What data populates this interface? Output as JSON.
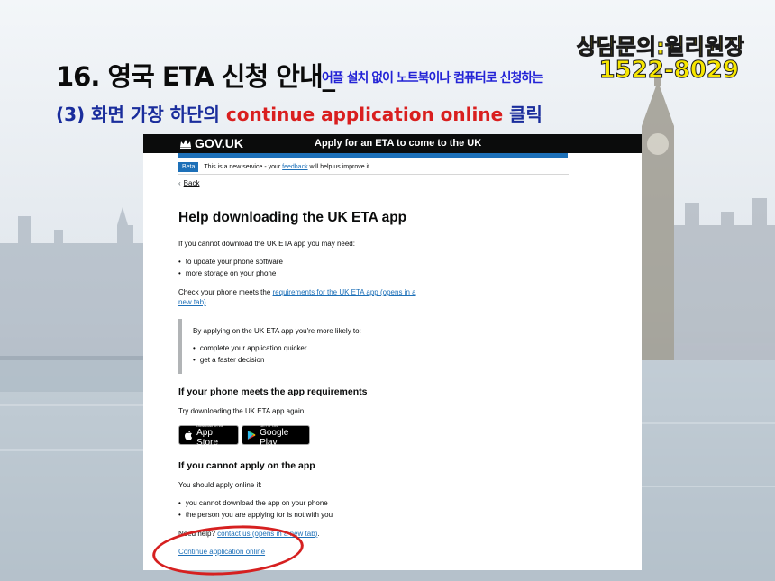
{
  "slide": {
    "title_main": "16. 영국 ETA 신청 안내_",
    "title_sub": "어플 설치 없이 노트북이나 컴퓨터로 신청하는",
    "contact_label": "상담문의:윌리원장",
    "contact_phone": "1522-8029",
    "subtitle_prefix": "(3) 화면 가장 하단의 ",
    "subtitle_highlight": "continue application online",
    "subtitle_suffix": " 클릭"
  },
  "header": {
    "logo": "GOV.UK",
    "service_name": "Apply for an ETA to come to the UK"
  },
  "phase_banner": {
    "tag": "Beta",
    "text_before": "This is a new service - your ",
    "link": "feedback",
    "text_after": " will help us improve it."
  },
  "back_link": "Back",
  "content": {
    "heading": "Help downloading the UK ETA app",
    "intro": "If you cannot download the UK ETA app you may need:",
    "needs": [
      "to update your phone software",
      "more storage on your phone"
    ],
    "check_before": "Check your phone meets the ",
    "check_link_line1": "requirements for the UK ETA app (opens in a",
    "check_link_line2": "new tab)",
    "check_after": ".",
    "inset_intro": "By applying on the UK ETA app you're more likely to:",
    "inset_items": [
      "complete your application quicker",
      "get a faster decision"
    ],
    "section1_heading": "If your phone meets the app requirements",
    "section1_text": "Try downloading the UK ETA app again.",
    "app_store_small": "Download on the",
    "app_store_big": "App Store",
    "google_play_small": "GET IT ON",
    "google_play_big": "Google Play",
    "section2_heading": "If you cannot apply on the app",
    "section2_intro": "You should apply online if:",
    "section2_items": [
      "you cannot download the app on your phone",
      "the person you are applying for is not with you"
    ],
    "help_before": "Need help? ",
    "help_link": "contact us (opens in a new tab)",
    "help_after": ".",
    "continue_link": "Continue application online"
  },
  "colors": {
    "gov_black": "#0b0c0c",
    "gov_blue": "#1d70b8",
    "highlight_red": "#d91f1f",
    "slide_title_blue": "#1a2d9c",
    "contact_yellow": "#f7e600"
  }
}
